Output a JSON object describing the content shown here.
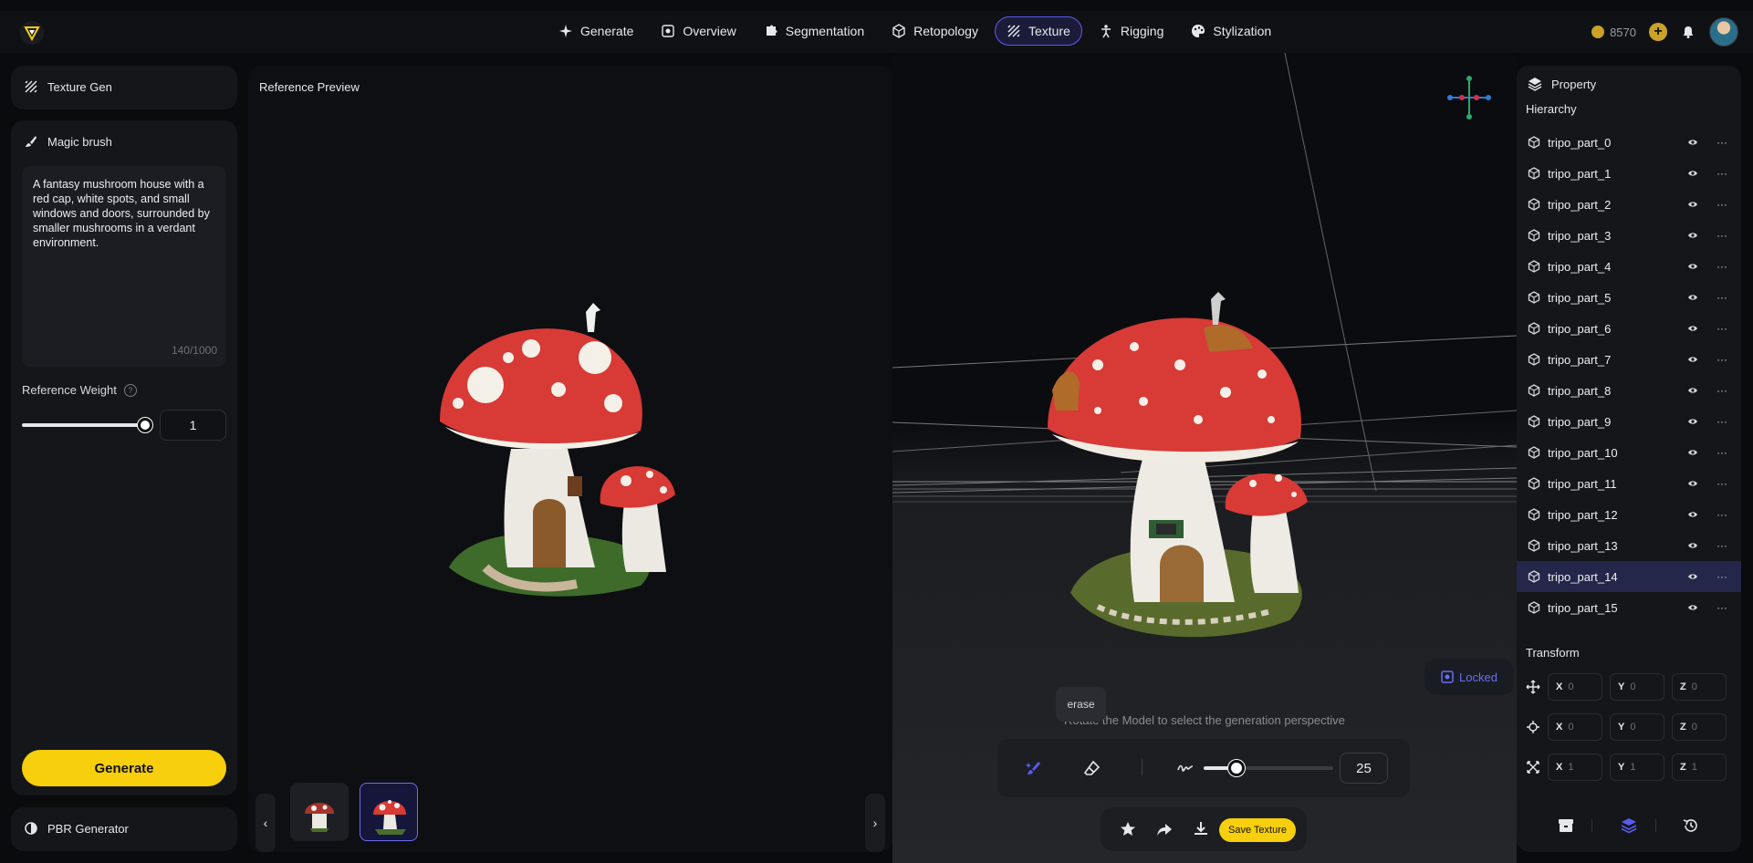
{
  "nav": {
    "tabs": [
      {
        "label": "Generate",
        "icon": "sparkle-icon"
      },
      {
        "label": "Overview",
        "icon": "frame-icon"
      },
      {
        "label": "Segmentation",
        "icon": "puzzle-icon"
      },
      {
        "label": "Retopology",
        "icon": "cube-mesh-icon"
      },
      {
        "label": "Texture",
        "icon": "texture-stripes-icon",
        "active": true
      },
      {
        "label": "Rigging",
        "icon": "figure-icon"
      },
      {
        "label": "Stylization",
        "icon": "palette-icon"
      }
    ]
  },
  "account": {
    "credits": "8570"
  },
  "left": {
    "texture_gen_title": "Texture Gen",
    "magic_brush_title": "Magic brush",
    "prompt": "A fantasy mushroom house with a red cap, white spots, and small windows and doors, surrounded by smaller mushrooms in a verdant environment.",
    "char_count": "140/1000",
    "reference_weight_label": "Reference Weight",
    "help_glyph": "?",
    "reference_weight": 1,
    "reference_weight_value": "1",
    "generate_label": "Generate",
    "pbr_title": "PBR Generator"
  },
  "preview": {
    "title": "Reference Preview",
    "prev_glyph": "‹",
    "next_glyph": "›"
  },
  "viewport": {
    "locked_label": "Locked",
    "hint": "Rotate the Model to select the generation perspective",
    "tooltip": "erase",
    "brush_size": 25,
    "brush_size_value": "25",
    "save_label": "Save Texture"
  },
  "property": {
    "title": "Property",
    "hierarchy_title": "Hierarchy",
    "parts": [
      "tripo_part_0",
      "tripo_part_1",
      "tripo_part_2",
      "tripo_part_3",
      "tripo_part_4",
      "tripo_part_5",
      "tripo_part_6",
      "tripo_part_7",
      "tripo_part_8",
      "tripo_part_9",
      "tripo_part_10",
      "tripo_part_11",
      "tripo_part_12",
      "tripo_part_13",
      "tripo_part_14",
      "tripo_part_15"
    ],
    "selected_index": 14,
    "more_glyph": "···",
    "transform_title": "Transform",
    "axis_labels": [
      "X",
      "Y",
      "Z"
    ],
    "position": [
      "0",
      "0",
      "0"
    ],
    "rotation": [
      "0",
      "0",
      "0"
    ],
    "scale": [
      "1",
      "1",
      "1"
    ]
  },
  "colors": {
    "accent": "#5b5cf0",
    "primary_button": "#f7cf0c",
    "panel": "#14161a"
  }
}
